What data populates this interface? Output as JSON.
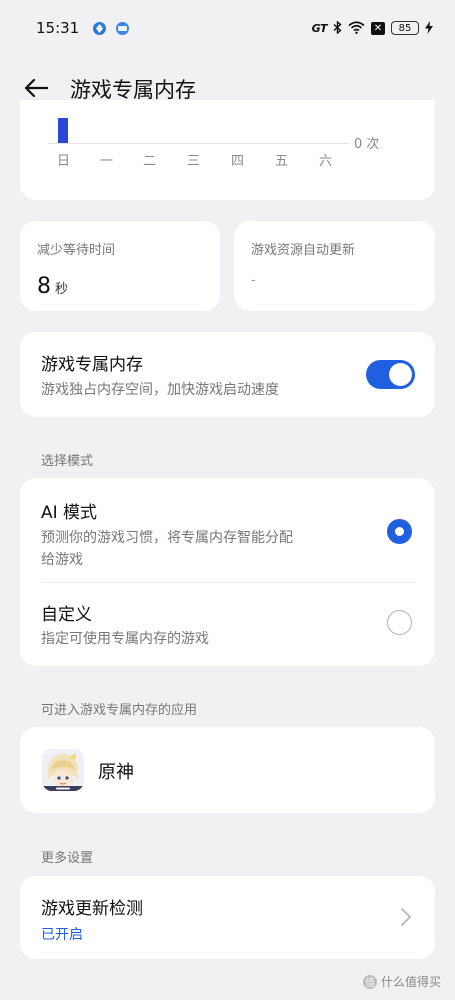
{
  "status_bar": {
    "time": "15:31",
    "gt_label": "GT",
    "bluetooth_icon": "bluetooth-icon",
    "wifi_icon": "wifi-icon",
    "x_box": "✕",
    "battery": "85"
  },
  "header": {
    "title": "游戏专属内存",
    "back_icon": "arrow-left-icon"
  },
  "chart": {
    "unit_label": "0 次",
    "days": [
      "日",
      "一",
      "二",
      "三",
      "四",
      "五",
      "六"
    ],
    "bar_color": "#2a46d6"
  },
  "metrics": {
    "wait_time": {
      "label": "减少等待时间",
      "value": "8",
      "unit": "秒"
    },
    "auto_update": {
      "label": "游戏资源自动更新",
      "value": "-"
    }
  },
  "dedicated_memory": {
    "title": "游戏专属内存",
    "subtitle": "游戏独占内存空间，加快游戏启动速度",
    "enabled": true
  },
  "mode_section": {
    "label": "选择模式",
    "ai": {
      "title": "AI 模式",
      "subtitle_line1": "预测你的游戏习惯，将专属内存智能分配",
      "subtitle_line2": "给游戏",
      "selected": true
    },
    "custom": {
      "title": "自定义",
      "subtitle": "指定可使用专属内存的游戏",
      "selected": false
    }
  },
  "apps_section": {
    "label": "可进入游戏专属内存的应用",
    "apps": [
      {
        "name": "原神",
        "icon": "genshin-app-icon"
      }
    ]
  },
  "more_section": {
    "label": "更多设置",
    "update_check": {
      "title": "游戏更新检测",
      "status": "已开启"
    }
  },
  "watermark": {
    "mark": "值",
    "text": "什么值得买"
  },
  "colors": {
    "accent": "#2060e0",
    "background": "#f1f1f3",
    "card": "#ffffff"
  }
}
